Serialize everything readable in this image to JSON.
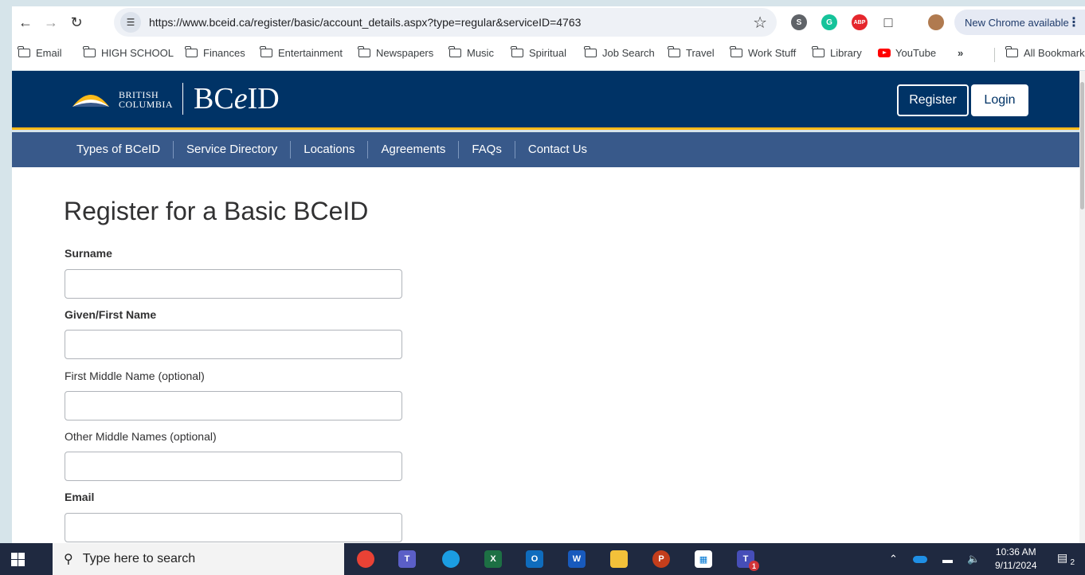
{
  "browser": {
    "url": "https://www.bceid.ca/register/basic/account_details.aspx?type=regular&serviceID=4763",
    "new_chrome": "New Chrome available"
  },
  "bookmarks": [
    {
      "label": "Email"
    },
    {
      "label": "HIGH SCHOOL"
    },
    {
      "label": "Finances"
    },
    {
      "label": "Entertainment"
    },
    {
      "label": "Newspapers"
    },
    {
      "label": "Music"
    },
    {
      "label": "Spiritual"
    },
    {
      "label": "Job Search"
    },
    {
      "label": "Travel"
    },
    {
      "label": "Work Stuff"
    },
    {
      "label": "Library"
    },
    {
      "label": "YouTube"
    },
    {
      "label": "All Bookmarks"
    }
  ],
  "header": {
    "logo_line1": "BRITISH",
    "logo_line2": "COLUMBIA",
    "site_title_pre": "BC",
    "site_title_e": "e",
    "site_title_post": "ID",
    "register_label": "Register",
    "login_label": "Login"
  },
  "nav": [
    {
      "label": "Types of BCeID"
    },
    {
      "label": "Service Directory"
    },
    {
      "label": "Locations"
    },
    {
      "label": "Agreements"
    },
    {
      "label": "FAQs"
    },
    {
      "label": "Contact Us"
    }
  ],
  "form": {
    "title": "Register for a Basic BCeID",
    "fields": [
      {
        "label": "Surname",
        "value": ""
      },
      {
        "label": "Given/First Name",
        "value": ""
      },
      {
        "label": "First Middle Name (optional)",
        "value": ""
      },
      {
        "label": "Other Middle Names (optional)",
        "value": ""
      },
      {
        "label": "Email",
        "value": ""
      }
    ]
  },
  "taskbar": {
    "search_placeholder": "Type here to search",
    "time": "10:36 AM",
    "date": "9/11/2024",
    "notification_count": "2",
    "teams_badge": "1"
  },
  "colors": {
    "bc_blue": "#003366",
    "bc_gold": "#fcba19",
    "nav_blue": "#38598a"
  }
}
